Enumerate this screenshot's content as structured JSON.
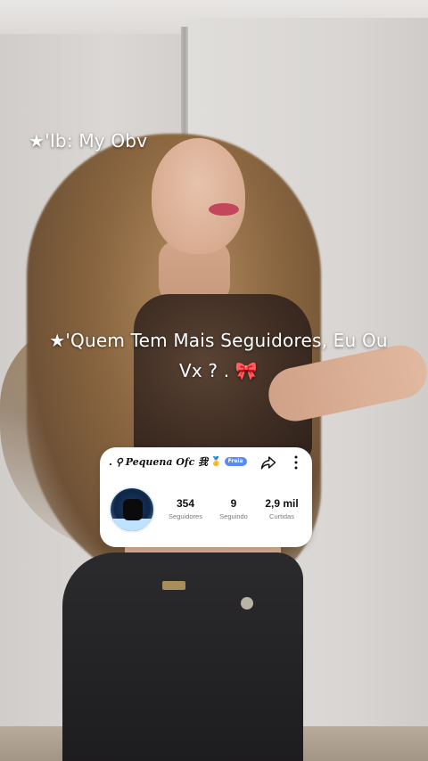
{
  "overlay": {
    "caption_top": "★'Ib: My Obv",
    "caption_main_line1": "★'Quem Tem Mais Seguidores, Eu Ou",
    "caption_main_line2": "Vx ? . 🎀"
  },
  "profile_card": {
    "name_prefix": ". ⚲",
    "name": "Pequena Ofc 我",
    "medal": "🥇",
    "verified_badge": "Freia",
    "share_icon": "share-icon",
    "more_icon": "more-vertical-icon",
    "stats": [
      {
        "value": "354",
        "label": "Seguidores"
      },
      {
        "value": "9",
        "label": "Seguindo"
      },
      {
        "value": "2,9 mil",
        "label": "Curtidas"
      }
    ]
  },
  "colors": {
    "badge_blue": "#5b8bf2",
    "caption_text": "#ffffff"
  }
}
